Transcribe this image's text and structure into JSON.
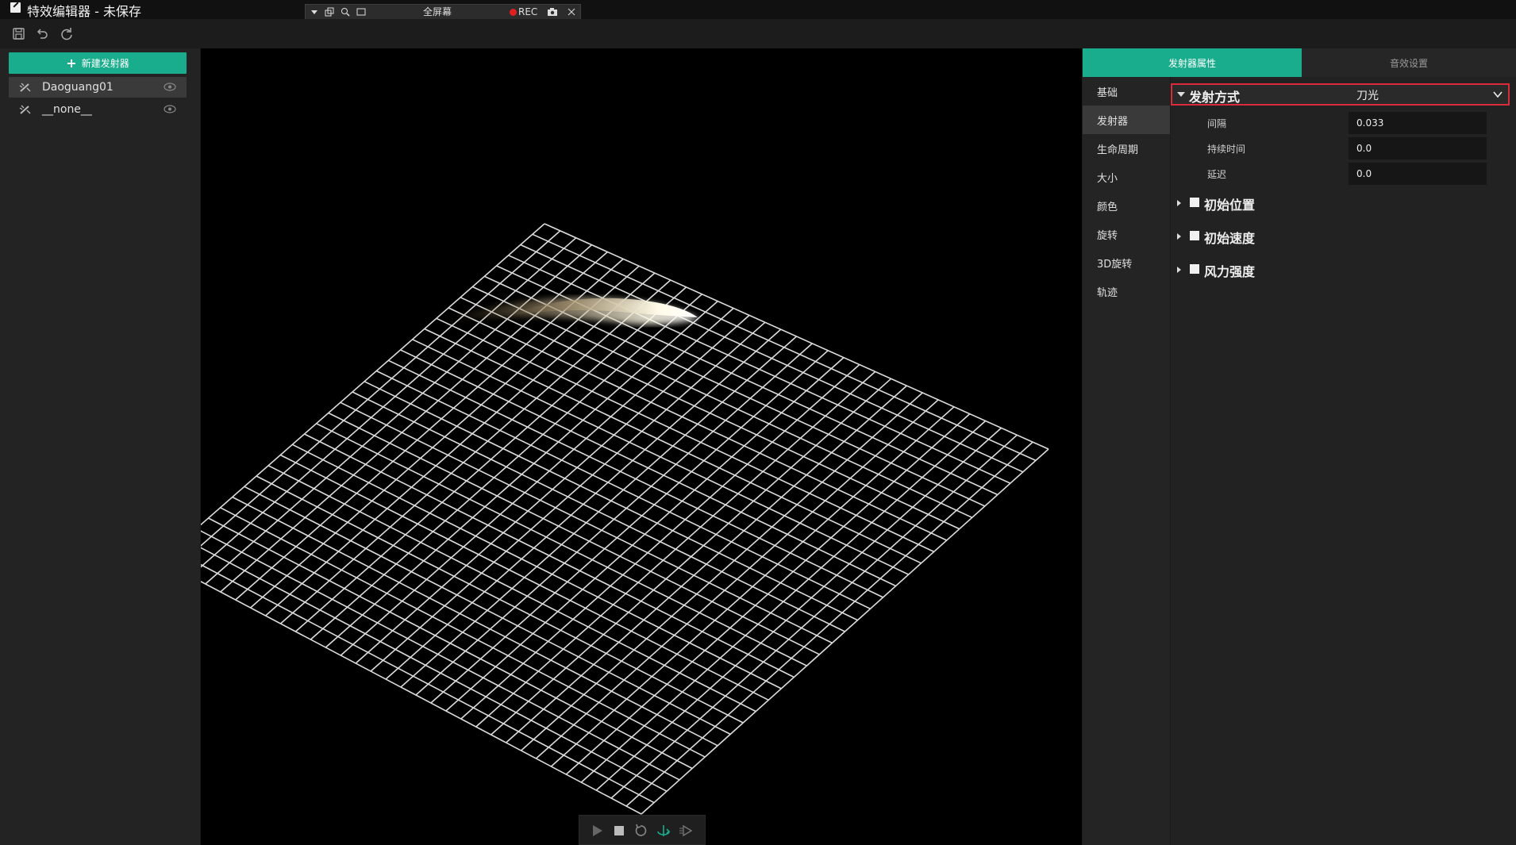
{
  "window": {
    "title": "特效编辑器 - 未保存"
  },
  "rec_bar": {
    "fullscreen_label": "全屏幕",
    "rec_label": "REC"
  },
  "left_panel": {
    "new_emitter_label": "新建发射器",
    "emitters": [
      {
        "name": "Daoguang01",
        "selected": true
      },
      {
        "name": "__none__",
        "selected": false
      }
    ]
  },
  "right_panel": {
    "tabs": [
      {
        "label": "发射器属性",
        "active": true
      },
      {
        "label": "音效设置",
        "active": false
      }
    ],
    "categories": [
      {
        "label": "基础",
        "selected": false
      },
      {
        "label": "发射器",
        "selected": true
      },
      {
        "label": "生命周期",
        "selected": false
      },
      {
        "label": "大小",
        "selected": false
      },
      {
        "label": "颜色",
        "selected": false
      },
      {
        "label": "旋转",
        "selected": false
      },
      {
        "label": "3D旋转",
        "selected": false
      },
      {
        "label": "轨迹",
        "selected": false
      }
    ],
    "emit_mode": {
      "label": "发射方式",
      "value": "刀光"
    },
    "fields": [
      {
        "label": "间隔",
        "value": "0.033"
      },
      {
        "label": "持续时间",
        "value": "0.0"
      },
      {
        "label": "延迟",
        "value": "0.0"
      }
    ],
    "sections": [
      {
        "label": "初始位置"
      },
      {
        "label": "初始速度"
      },
      {
        "label": "风力强度"
      }
    ]
  },
  "colors": {
    "accent": "#1aad8d",
    "highlight": "#d92b3a"
  }
}
